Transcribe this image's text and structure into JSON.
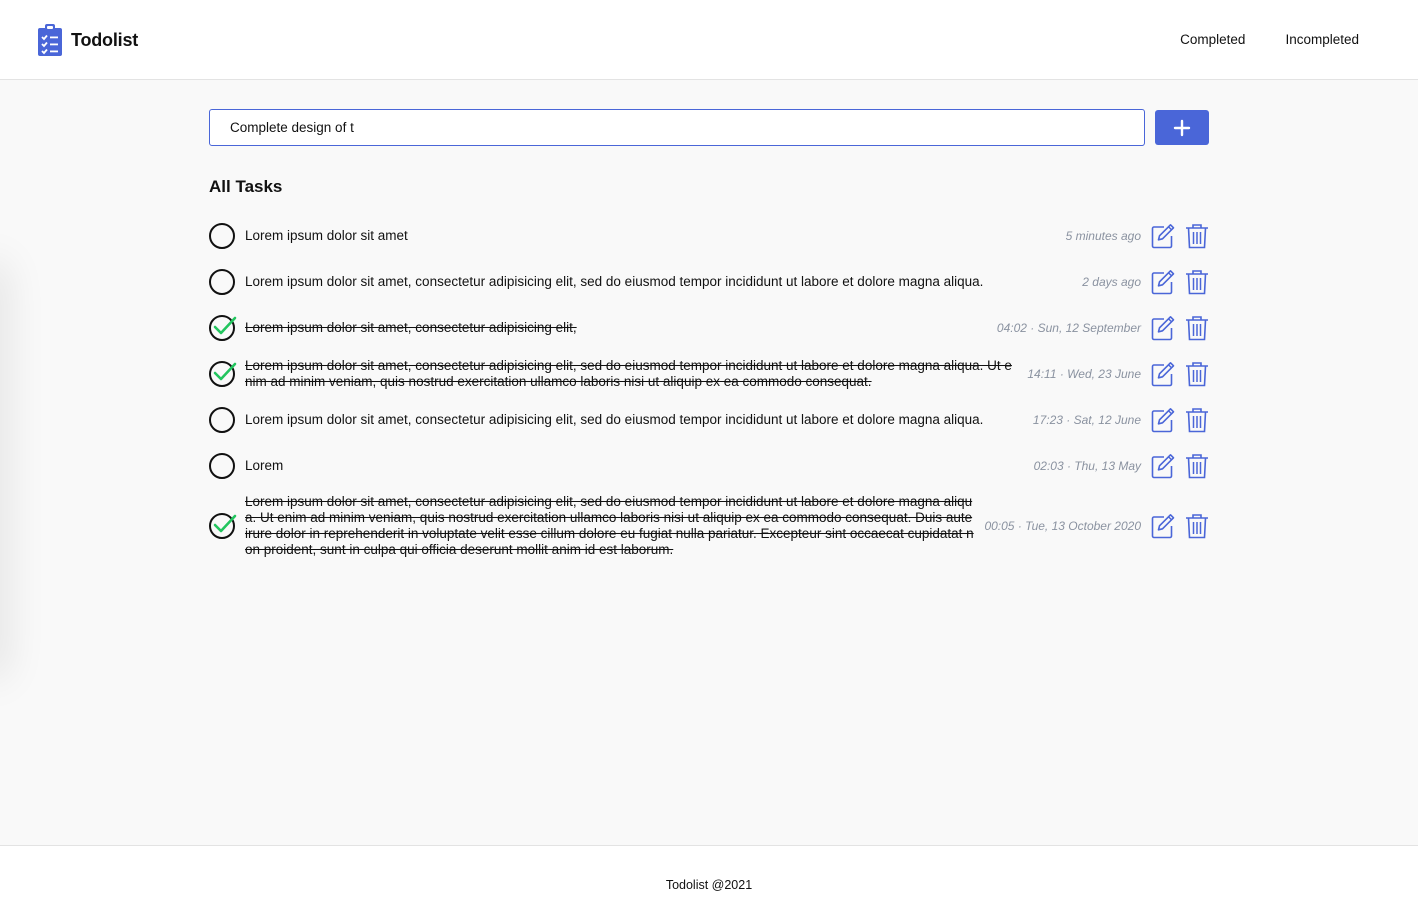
{
  "app": {
    "name": "Todolist",
    "brand_color": "#4a66d8"
  },
  "nav": {
    "completed_label": "Completed",
    "incompleted_label": "Incompleted"
  },
  "add_task": {
    "input_value": "Complete design of t",
    "button_icon": "plus-icon"
  },
  "section": {
    "title": "All Tasks"
  },
  "tasks": [
    {
      "text": "Lorem ipsum dolor sit amet",
      "time": "5 minutes ago",
      "done": false
    },
    {
      "text": "Lorem ipsum dolor sit amet, consectetur adipisicing elit, sed do eiusmod tempor incididunt ut labore et dolore magna aliqua.",
      "time": "2 days ago",
      "done": false
    },
    {
      "text": "Lorem ipsum dolor sit amet, consectetur adipisicing elit,",
      "time": "04:02 · Sun, 12 September",
      "done": true
    },
    {
      "text": "Lorem ipsum dolor sit amet, consectetur adipisicing elit, sed do eiusmod tempor incididunt ut labore et dolore magna aliqua. Ut enim ad minim veniam, quis nostrud exercitation ullamco laboris nisi ut aliquip ex ea commodo consequat.",
      "time": "14:11 · Wed, 23 June",
      "done": true
    },
    {
      "text": "Lorem ipsum dolor sit amet, consectetur adipisicing elit, sed do eiusmod tempor incididunt ut labore et dolore magna aliqua.",
      "time": "17:23 · Sat, 12 June",
      "done": false
    },
    {
      "text": "Lorem",
      "time": "02:03 · Thu, 13 May",
      "done": false
    },
    {
      "text": "Lorem ipsum dolor sit amet, consectetur adipisicing elit, sed do eiusmod tempor incididunt ut labore et dolore magna aliqua. Ut enim ad minim veniam, quis nostrud exercitation ullamco laboris nisi ut aliquip ex ea commodo consequat. Duis aute irure dolor in reprehenderit in voluptate velit esse cillum dolore eu fugiat nulla pariatur. Excepteur sint occaecat cupidatat non proident, sunt in culpa qui officia deserunt mollit anim id est laborum.",
      "time": "00:05 · Tue, 13 October 2020",
      "done": true
    }
  ],
  "colors": {
    "check_green": "#22c55e",
    "icon_blue": "#4a66d8",
    "time_gray": "#8a92a0"
  },
  "footer": {
    "text": "Todolist @2021"
  }
}
